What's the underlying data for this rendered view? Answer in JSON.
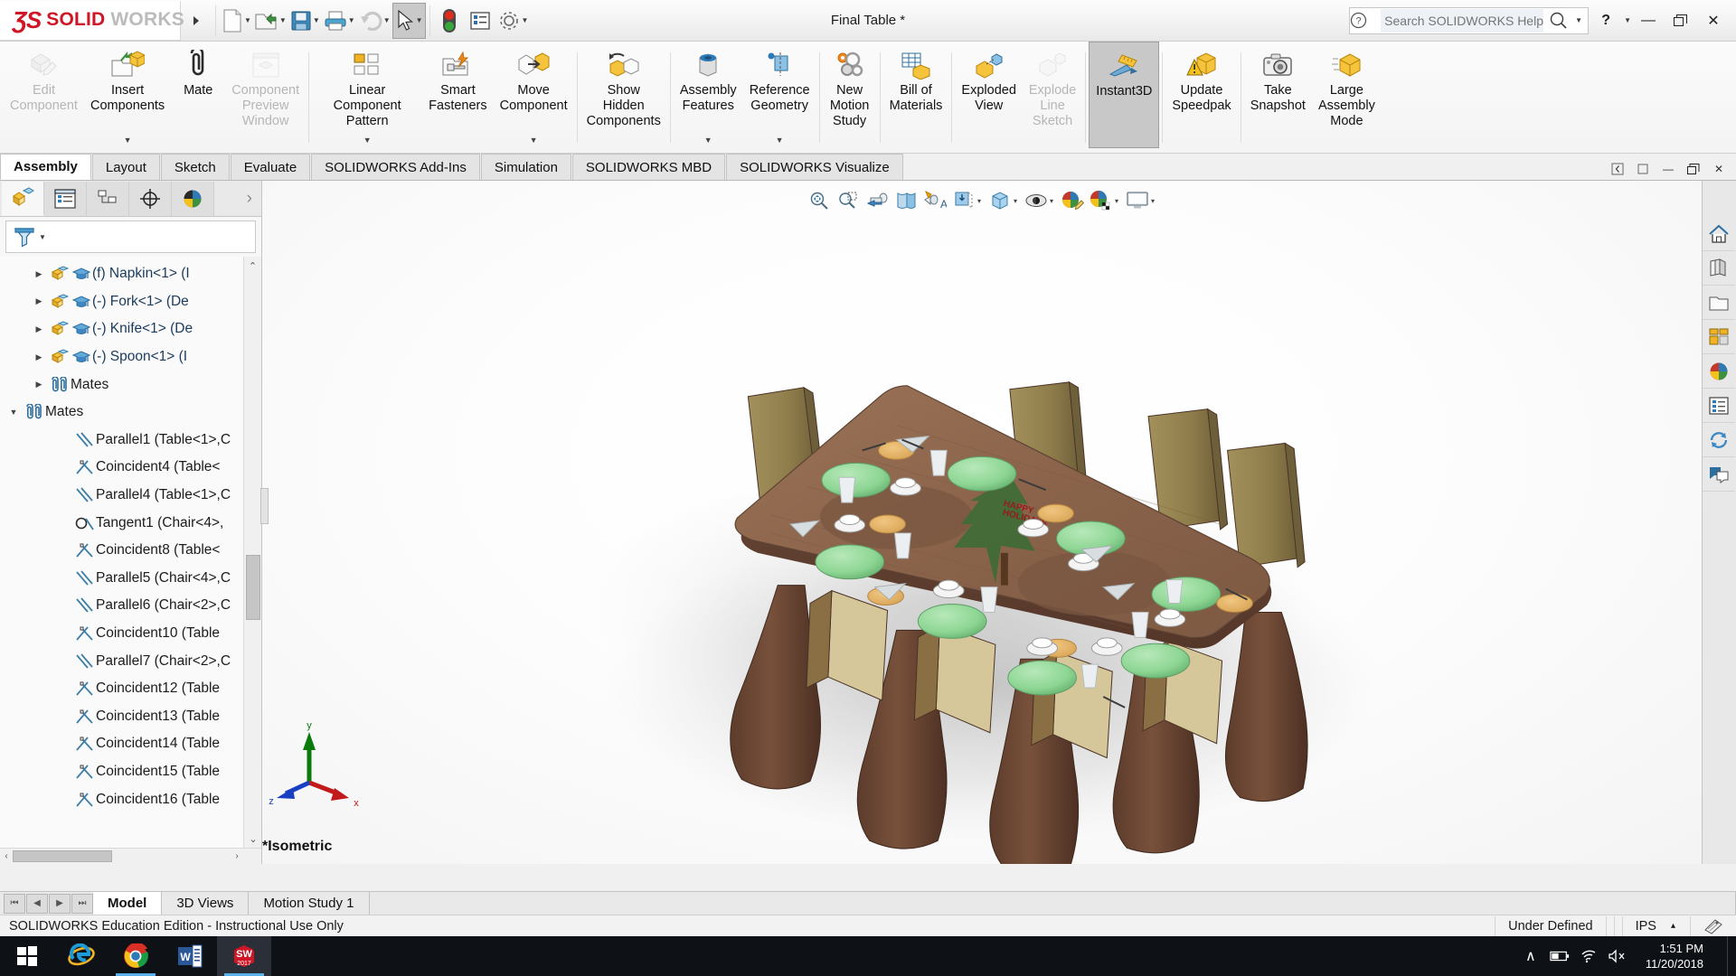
{
  "app": {
    "brand_ds": "ƷS",
    "brand_solid": "SOLID",
    "brand_works": "WORKS",
    "document_title": "Final Table *",
    "brand_color": "#cf1627"
  },
  "titlebar": {
    "quick_access": [
      {
        "name": "new-document",
        "label": "New",
        "caret": true
      },
      {
        "name": "open-document",
        "label": "Open",
        "caret": true
      },
      {
        "name": "save-document",
        "label": "Save",
        "caret": true
      },
      {
        "name": "print-document",
        "label": "Print",
        "caret": true
      },
      {
        "name": "undo",
        "label": "Undo",
        "caret": true
      },
      {
        "name": "select-tool",
        "label": "Select",
        "caret": true
      },
      {
        "name": "rebuild",
        "label": "Rebuild",
        "caret": false
      },
      {
        "name": "options-list",
        "label": "Options",
        "caret": false
      },
      {
        "name": "settings-gear",
        "label": "Options",
        "caret": true
      }
    ],
    "search_placeholder": "Search SOLIDWORKS Help",
    "help_label": "?",
    "minimize_label": "—",
    "restore_label": "❐",
    "close_label": "✕"
  },
  "ribbon": {
    "items": [
      {
        "label": "Edit\nComponent",
        "icon": "edit-component-icon",
        "disabled": true,
        "dropdown": false,
        "selected": false
      },
      {
        "label": "Insert\nComponents",
        "icon": "insert-components-icon",
        "disabled": false,
        "dropdown": true,
        "selected": false
      },
      {
        "label": "Mate",
        "icon": "mate-icon",
        "disabled": false,
        "dropdown": false,
        "selected": false
      },
      {
        "label": "Component\nPreview\nWindow",
        "icon": "component-preview-icon",
        "disabled": true,
        "dropdown": false,
        "selected": false
      },
      {
        "label": "Linear Component\nPattern",
        "icon": "linear-pattern-icon",
        "disabled": false,
        "dropdown": true,
        "selected": false
      },
      {
        "label": "Smart\nFasteners",
        "icon": "smart-fasteners-icon",
        "disabled": false,
        "dropdown": false,
        "selected": false
      },
      {
        "label": "Move\nComponent",
        "icon": "move-component-icon",
        "disabled": false,
        "dropdown": true,
        "selected": false
      },
      {
        "label": "Show\nHidden\nComponents",
        "icon": "show-hidden-icon",
        "disabled": false,
        "dropdown": false,
        "selected": false
      },
      {
        "label": "Assembly\nFeatures",
        "icon": "assembly-features-icon",
        "disabled": false,
        "dropdown": true,
        "selected": false
      },
      {
        "label": "Reference\nGeometry",
        "icon": "reference-geometry-icon",
        "disabled": false,
        "dropdown": true,
        "selected": false
      },
      {
        "label": "New\nMotion\nStudy",
        "icon": "new-motion-study-icon",
        "disabled": false,
        "dropdown": false,
        "selected": false
      },
      {
        "label": "Bill of\nMaterials",
        "icon": "bill-of-materials-icon",
        "disabled": false,
        "dropdown": false,
        "selected": false
      },
      {
        "label": "Exploded\nView",
        "icon": "exploded-view-icon",
        "disabled": false,
        "dropdown": false,
        "selected": false
      },
      {
        "label": "Explode\nLine\nSketch",
        "icon": "explode-line-sketch-icon",
        "disabled": true,
        "dropdown": false,
        "selected": false
      },
      {
        "label": "Instant3D",
        "icon": "instant3d-icon",
        "disabled": false,
        "dropdown": false,
        "selected": true
      },
      {
        "label": "Update\nSpeedpak",
        "icon": "update-speedpak-icon",
        "disabled": false,
        "dropdown": false,
        "selected": false
      },
      {
        "label": "Take\nSnapshot",
        "icon": "take-snapshot-icon",
        "disabled": false,
        "dropdown": false,
        "selected": false
      },
      {
        "label": "Large\nAssembly\nMode",
        "icon": "large-assembly-mode-icon",
        "disabled": false,
        "dropdown": false,
        "selected": false
      }
    ],
    "dividers_after": [
      3,
      6,
      7,
      9,
      10,
      11,
      13,
      14,
      15
    ]
  },
  "command_tabs": {
    "tabs": [
      {
        "label": "Assembly",
        "active": true
      },
      {
        "label": "Layout",
        "active": false
      },
      {
        "label": "Sketch",
        "active": false
      },
      {
        "label": "Evaluate",
        "active": false
      },
      {
        "label": "SOLIDWORKS Add-Ins",
        "active": false
      },
      {
        "label": "Simulation",
        "active": false
      },
      {
        "label": "SOLIDWORKS MBD",
        "active": false
      },
      {
        "label": "SOLIDWORKS Visualize",
        "active": false
      }
    ],
    "window_controls": [
      "◀",
      "▫",
      "—",
      "❐",
      "✕"
    ]
  },
  "feature_tree": {
    "tabs": [
      {
        "name": "feature-manager-tab",
        "icon": "assembly-tree-icon",
        "active": true
      },
      {
        "name": "property-manager-tab",
        "icon": "property-list-icon",
        "active": false
      },
      {
        "name": "configuration-manager-tab",
        "icon": "configuration-icon",
        "active": false
      },
      {
        "name": "dimxpert-manager-tab",
        "icon": "dimxpert-icon",
        "active": false
      },
      {
        "name": "display-manager-tab",
        "icon": "display-manager-icon",
        "active": false
      }
    ],
    "more_tabs": "›",
    "filter_placeholder": "",
    "nodes": [
      {
        "label": "(f) Napkin<1> (I",
        "indent": 1,
        "arrow": "collapsed",
        "icon": "component-icon",
        "education": true
      },
      {
        "label": "(-) Fork<1> (De",
        "indent": 1,
        "arrow": "collapsed",
        "icon": "component-icon",
        "education": true
      },
      {
        "label": "(-) Knife<1> (De",
        "indent": 1,
        "arrow": "collapsed",
        "icon": "component-icon",
        "education": true
      },
      {
        "label": "(-) Spoon<1> (I",
        "indent": 1,
        "arrow": "collapsed",
        "icon": "component-icon",
        "education": true
      },
      {
        "label": "Mates",
        "indent": 1,
        "arrow": "collapsed",
        "icon": "mates-icon",
        "education": false
      },
      {
        "label": "Mates",
        "indent": 0,
        "arrow": "expanded",
        "icon": "mates-icon",
        "education": false
      },
      {
        "label": "Parallel1 (Table<1>,C",
        "indent": 2,
        "arrow": "none",
        "icon": "parallel-icon",
        "education": false
      },
      {
        "label": "Coincident4 (Table<",
        "indent": 2,
        "arrow": "none",
        "icon": "coincident-icon",
        "education": false
      },
      {
        "label": "Parallel4 (Table<1>,C",
        "indent": 2,
        "arrow": "none",
        "icon": "parallel-icon",
        "education": false
      },
      {
        "label": "Tangent1 (Chair<4>,",
        "indent": 2,
        "arrow": "none",
        "icon": "tangent-icon",
        "education": false
      },
      {
        "label": "Coincident8 (Table<",
        "indent": 2,
        "arrow": "none",
        "icon": "coincident-icon",
        "education": false
      },
      {
        "label": "Parallel5 (Chair<4>,C",
        "indent": 2,
        "arrow": "none",
        "icon": "parallel-icon",
        "education": false
      },
      {
        "label": "Parallel6 (Chair<2>,C",
        "indent": 2,
        "arrow": "none",
        "icon": "parallel-icon",
        "education": false
      },
      {
        "label": "Coincident10 (Table",
        "indent": 2,
        "arrow": "none",
        "icon": "coincident-icon",
        "education": false
      },
      {
        "label": "Parallel7 (Chair<2>,C",
        "indent": 2,
        "arrow": "none",
        "icon": "parallel-icon",
        "education": false
      },
      {
        "label": "Coincident12 (Table",
        "indent": 2,
        "arrow": "none",
        "icon": "coincident-icon",
        "education": false
      },
      {
        "label": "Coincident13 (Table",
        "indent": 2,
        "arrow": "none",
        "icon": "coincident-icon",
        "education": false
      },
      {
        "label": "Coincident14 (Table",
        "indent": 2,
        "arrow": "none",
        "icon": "coincident-icon",
        "education": false
      },
      {
        "label": "Coincident15 (Table",
        "indent": 2,
        "arrow": "none",
        "icon": "coincident-icon",
        "education": false
      },
      {
        "label": "Coincident16 (Table",
        "indent": 2,
        "arrow": "none",
        "icon": "coincident-icon",
        "education": false
      }
    ]
  },
  "viewport": {
    "heads_up_tools": [
      {
        "name": "zoom-to-fit-icon",
        "caret": false
      },
      {
        "name": "zoom-to-area-icon",
        "caret": false
      },
      {
        "name": "previous-view-icon",
        "caret": false
      },
      {
        "name": "section-view-icon",
        "caret": false
      },
      {
        "name": "view-orientation-text-icon",
        "caret": false
      },
      {
        "name": "view-orientation-icon",
        "caret": true
      },
      {
        "name": "display-style-icon",
        "caret": true
      },
      {
        "name": "hide-show-items-icon",
        "caret": true
      },
      {
        "name": "edit-appearance-icon",
        "caret": false
      },
      {
        "name": "apply-scene-icon",
        "caret": true
      },
      {
        "name": "view-settings-icon",
        "caret": true
      }
    ],
    "view_label": "*Isometric",
    "triad": {
      "x_label": "x",
      "y_label": "y",
      "z_label": "z"
    },
    "model_text": "HAPPY HOLIDAYS"
  },
  "task_pane": {
    "buttons": [
      {
        "name": "solidworks-resources-icon"
      },
      {
        "name": "design-library-icon"
      },
      {
        "name": "file-explorer-icon"
      },
      {
        "name": "view-palette-icon"
      },
      {
        "name": "appearances-scenes-icon"
      },
      {
        "name": "custom-properties-icon"
      },
      {
        "name": "solidworks-forum-icon"
      },
      {
        "name": "solidworks-chat-icon"
      }
    ]
  },
  "bottom_tabs": {
    "nav_buttons": [
      "⏮",
      "◀",
      "▶",
      "⏭"
    ],
    "tabs": [
      {
        "label": "Model",
        "active": true
      },
      {
        "label": "3D Views",
        "active": false
      },
      {
        "label": "Motion Study 1",
        "active": false
      }
    ]
  },
  "status_bar": {
    "message": "SOLIDWORKS Education Edition - Instructional Use Only",
    "state": "Under Defined",
    "units": "IPS",
    "units_caret": "▴"
  },
  "taskbar": {
    "items": [
      {
        "name": "start-button",
        "label": "Start"
      },
      {
        "name": "internet-explorer-button",
        "label": "Internet Explorer"
      },
      {
        "name": "google-chrome-button",
        "label": "Google Chrome"
      },
      {
        "name": "microsoft-word-button",
        "label": "Microsoft Word"
      },
      {
        "name": "solidworks-button",
        "label": "SW 2017"
      }
    ],
    "sw_year": "2017",
    "tray": {
      "chevron": "∧",
      "time": "1:51 PM",
      "date": "11/20/2018"
    }
  }
}
